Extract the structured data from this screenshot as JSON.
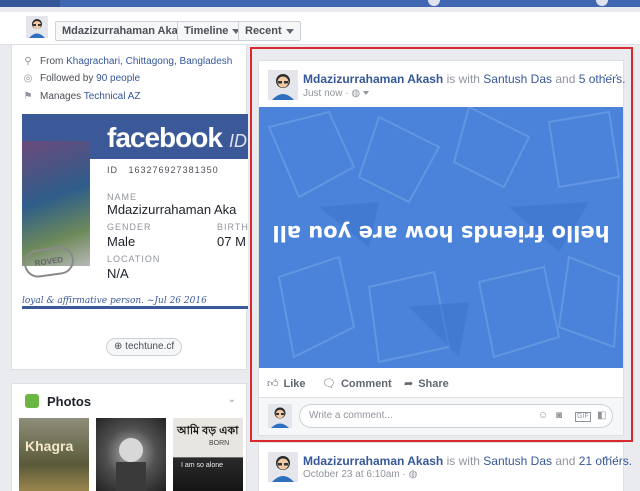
{
  "subnav": {
    "name": "Mdazizurrahaman Akash",
    "timeline": "Timeline",
    "recent": "Recent"
  },
  "intro": {
    "from_prefix": "From",
    "from_place": "Khagrachari, Chittagong, Bangladesh",
    "followed_prefix": "Followed by",
    "followed_count": "90 people",
    "manages_prefix": "Manages",
    "manages_page": "Technical AZ"
  },
  "idcard": {
    "brand": "facebook",
    "brand_suffix": "ID",
    "id_label": "ID",
    "id_value": "163276927381350",
    "name_label": "NAME",
    "name_value": "Mdazizurrahaman Aka",
    "gender_label": "GENDER",
    "gender_value": "Male",
    "birth_label": "BIRTH",
    "birth_value": "07 M",
    "location_label": "LOCATION",
    "location_value": "N/A",
    "stamp": "ROVED",
    "signature": "loyal & affirmative person. ~Jul 26 2016",
    "accent": "#3b5998"
  },
  "link_chip": "techtune.cf",
  "photos": {
    "title": "Photos",
    "thumb1_text": "Khagra",
    "thumb3_line1": "আমি বড় একা",
    "thumb3_line2": "I am so alone",
    "thumb3_line3": "BORN"
  },
  "post": {
    "author": "Mdazizurrahaman Akash",
    "is_with": "is with",
    "friend": "Santush Das",
    "and": "and",
    "others": "5 others.",
    "time": "Just now",
    "privacy_icon": "globe-icon",
    "banner_text": "hello friends how are you all",
    "banner_color": "#4a83d9",
    "like": "Like",
    "comment": "Comment",
    "share": "Share",
    "comment_placeholder": "Write a comment...",
    "gif": "GIF",
    "highlight_color": "#d9282f"
  },
  "post2": {
    "author": "Mdazizurrahaman Akash",
    "is_with": "is with",
    "friend": "Santush Das",
    "and": "and",
    "others": "21 others.",
    "time": "October 23 at 6:10am"
  }
}
